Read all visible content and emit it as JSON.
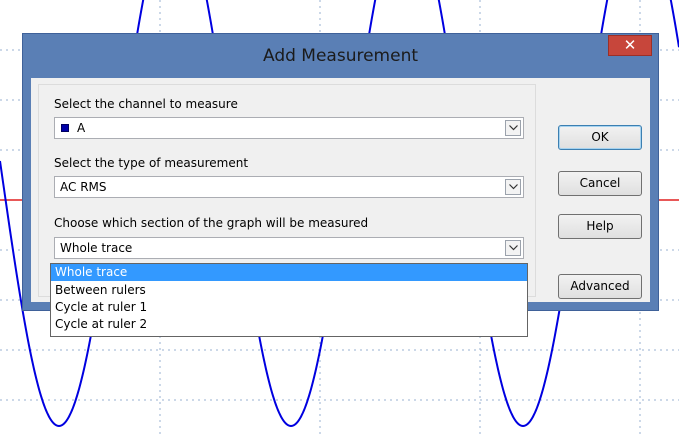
{
  "dialog": {
    "title": "Add Measurement",
    "close_label": "✕",
    "channel_label": "Select the channel to measure",
    "channel_value": "A",
    "channel_color": "#0000a8",
    "type_label": "Select the type of measurement",
    "type_value": "AC RMS",
    "section_label": "Choose which section of the graph will be measured",
    "section_value": "Whole trace",
    "section_options": [
      "Whole trace",
      "Between rulers",
      "Cycle at ruler 1",
      "Cycle at ruler 2"
    ],
    "selected_option": "Whole trace",
    "buttons": {
      "ok": "OK",
      "cancel": "Cancel",
      "help": "Help",
      "advanced": "Advanced"
    }
  },
  "colors": {
    "trace": "#0000e0",
    "ruler": "#e02020",
    "grid": "#9ab0d0",
    "title_bar": "#5a7fb5",
    "selection": "#3399ff"
  }
}
